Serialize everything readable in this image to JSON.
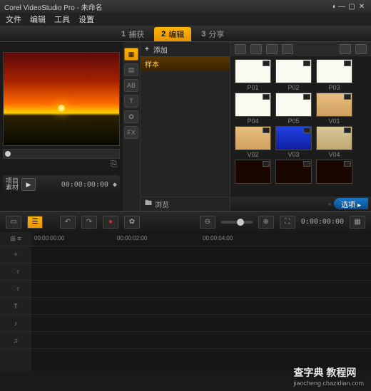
{
  "title": "Corel VideoStudio Pro - 未命名",
  "menu": [
    "文件",
    "编辑",
    "工具",
    "设置"
  ],
  "steps": [
    {
      "num": "1",
      "label": "捕获",
      "active": false
    },
    {
      "num": "2",
      "label": "编辑",
      "active": true
    },
    {
      "num": "3",
      "label": "分享",
      "active": false
    }
  ],
  "preview": {
    "label_project": "项目",
    "label_clip": "素材",
    "timecode": "00:00:00:00 ◆"
  },
  "vtabs": [
    "▦",
    "▤",
    "AB",
    "T",
    "✪",
    "FX"
  ],
  "folder": {
    "add": "添加",
    "sample": "样本",
    "browse": "浏览"
  },
  "library": {
    "thumbs": [
      [
        {
          "label": "P01",
          "cls": "th-white"
        },
        {
          "label": "P02",
          "cls": "th-white"
        },
        {
          "label": "P03",
          "cls": "th-white"
        }
      ],
      [
        {
          "label": "P04",
          "cls": "th-white"
        },
        {
          "label": "P05",
          "cls": "th-white"
        },
        {
          "label": "V01",
          "cls": "th-orange"
        }
      ],
      [
        {
          "label": "V02",
          "cls": "th-orange"
        },
        {
          "label": "V03",
          "cls": "th-blue"
        },
        {
          "label": "V04",
          "cls": "th-paper"
        }
      ],
      [
        {
          "label": "",
          "cls": "th-dark"
        },
        {
          "label": "",
          "cls": "th-dark"
        },
        {
          "label": "",
          "cls": "th-dark"
        }
      ]
    ],
    "options": "选项 ▸"
  },
  "timeline": {
    "timecode": "0:00:00:00",
    "marks": [
      "00:00:00:00",
      "00:00:02:00",
      "00:00:04:00"
    ],
    "tracks": [
      "⊞",
      "✧",
      "ೕ",
      "ೕ",
      "T",
      "♪",
      "♫"
    ]
  },
  "watermark": {
    "main": "查字典 教程网",
    "sub": "jiaocheng.chazidian.com"
  }
}
